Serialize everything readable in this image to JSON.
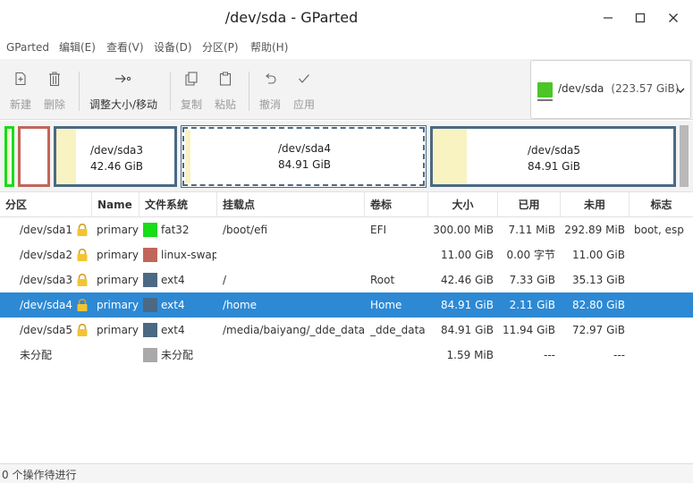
{
  "window": {
    "title": "/dev/sda - GParted"
  },
  "menu": [
    "GParted",
    "编辑(E)",
    "查看(V)",
    "设备(D)",
    "分区(P)",
    "帮助(H)"
  ],
  "toolbar": {
    "new": "新建",
    "delete": "删除",
    "resize": "调整大小/移动",
    "copy": "复制",
    "paste": "粘贴",
    "undo": "撤消",
    "apply": "应用"
  },
  "device": {
    "path": "/dev/sda",
    "size": "(223.57 GiB)",
    "icon": "disk-icon"
  },
  "diskmap": {
    "sda3": {
      "name": "/dev/sda3",
      "size": "42.46 GiB"
    },
    "sda4": {
      "name": "/dev/sda4",
      "size": "84.91 GiB"
    },
    "sda5": {
      "name": "/dev/sda5",
      "size": "84.91 GiB"
    }
  },
  "table": {
    "headers": [
      "分区",
      "Name",
      "文件系统",
      "挂载点",
      "卷标",
      "大小",
      "已用",
      "未用",
      "标志"
    ],
    "rows": [
      {
        "partition": "/dev/sda1",
        "name": "primary",
        "fs": "fat32",
        "mount": "/boot/efi",
        "label": "EFI",
        "size": "300.00 MiB",
        "used": "7.11 MiB",
        "unused": "292.89 MiB",
        "flags": "boot, esp",
        "locked": true,
        "color": "#18dc18"
      },
      {
        "partition": "/dev/sda2",
        "name": "primary",
        "fs": "linux-swap",
        "mount": "",
        "label": "",
        "size": "11.00 GiB",
        "used": "0.00 字节",
        "unused": "11.00 GiB",
        "flags": "",
        "locked": true,
        "color": "#c1665a"
      },
      {
        "partition": "/dev/sda3",
        "name": "primary",
        "fs": "ext4",
        "mount": "/",
        "label": "Root",
        "size": "42.46 GiB",
        "used": "7.33 GiB",
        "unused": "35.13 GiB",
        "flags": "",
        "locked": true,
        "color": "#4b6983"
      },
      {
        "partition": "/dev/sda4",
        "name": "primary",
        "fs": "ext4",
        "mount": "/home",
        "label": "Home",
        "size": "84.91 GiB",
        "used": "2.11 GiB",
        "unused": "82.80 GiB",
        "flags": "",
        "locked": true,
        "color": "#4b6983",
        "selected": true
      },
      {
        "partition": "/dev/sda5",
        "name": "primary",
        "fs": "ext4",
        "mount": "/media/baiyang/_dde_data",
        "label": "_dde_data",
        "size": "84.91 GiB",
        "used": "11.94 GiB",
        "unused": "72.97 GiB",
        "flags": "",
        "locked": true,
        "color": "#4b6983"
      },
      {
        "partition": "未分配",
        "name": "",
        "fs": "未分配",
        "mount": "",
        "label": "",
        "size": "1.59 MiB",
        "used": "---",
        "unused": "---",
        "flags": "",
        "locked": false,
        "color": "#a9a9a9"
      }
    ]
  },
  "status": {
    "text": "0 个操作待进行"
  },
  "colors": {
    "accent": "#2d89d4",
    "fat32": "#18dc18",
    "linux_swap": "#c1665a",
    "ext4": "#4b6983",
    "unallocated": "#a9a9a9",
    "used_fill": "#f8f3c1"
  }
}
